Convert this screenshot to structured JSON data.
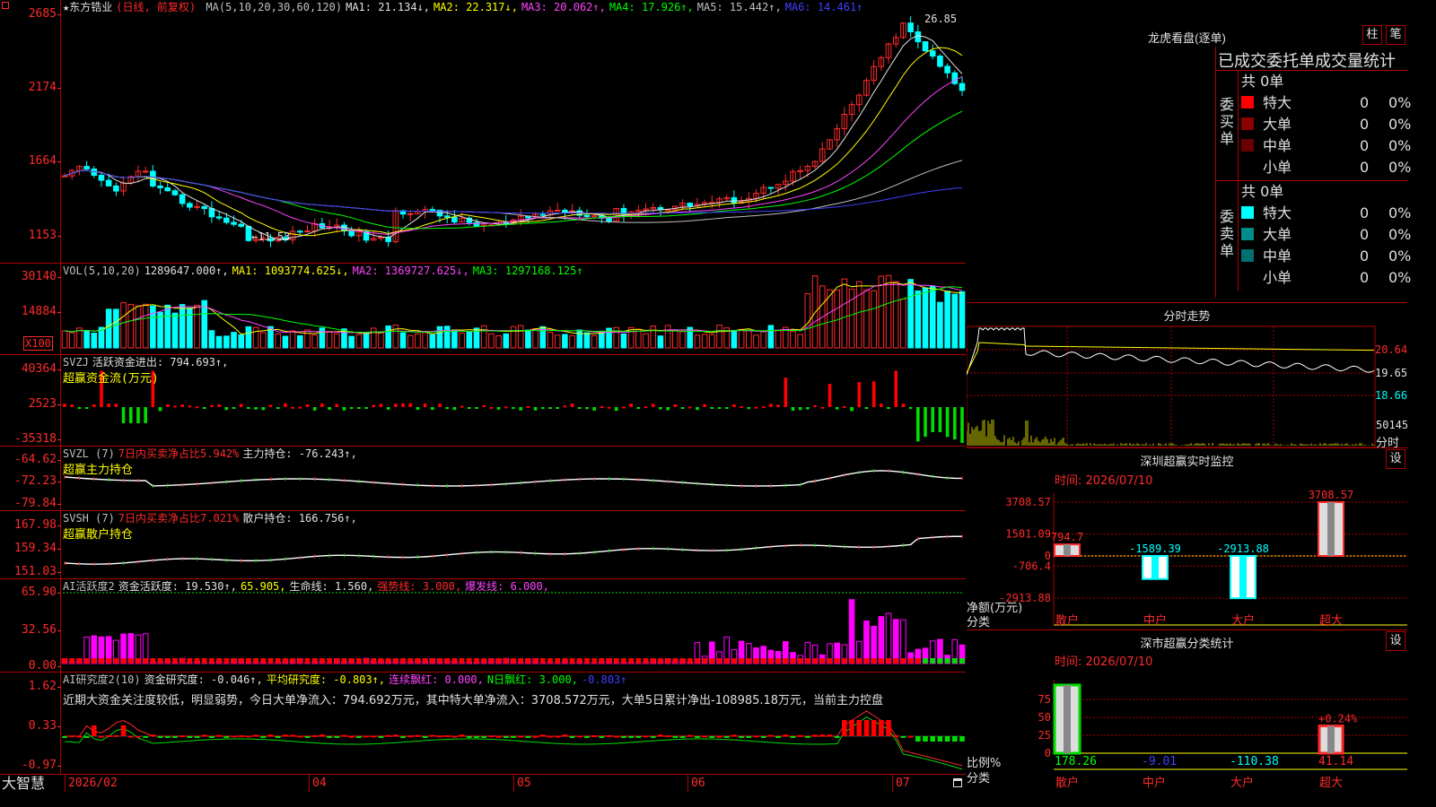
{
  "stock": {
    "name": "★东方锆业",
    "period": "(日线, 前复权)"
  },
  "kline": {
    "legend": [
      {
        "text": "MA(5,10,20,30,60,120)",
        "color": "#c0c0c0"
      },
      {
        "text": "MA1: 21.134↓,",
        "color": "#e0e0e0"
      },
      {
        "text": "MA2: 22.317↓,",
        "color": "#ffff00"
      },
      {
        "text": "MA3: 20.062↑,",
        "color": "#ff44ff"
      },
      {
        "text": "MA4: 17.926↑,",
        "color": "#00ff00"
      },
      {
        "text": "MA5: 15.442↑,",
        "color": "#c0c0c0"
      },
      {
        "text": "MA6: 14.461↑",
        "color": "#4040ff"
      }
    ],
    "ticks": [
      "2685",
      "2174",
      "1664",
      "1153"
    ],
    "high_label": "26.85",
    "low_label": "←11.53"
  },
  "vol": {
    "legend": [
      {
        "text": "VOL(5,10,20)",
        "color": "#c0c0c0"
      },
      {
        "text": "1289647.000↑,",
        "color": "#e0e0e0"
      },
      {
        "text": "MA1: 1093774.625↓,",
        "color": "#ffff00"
      },
      {
        "text": "MA2: 1369727.625↓,",
        "color": "#ff44ff"
      },
      {
        "text": "MA3: 1297168.125↑",
        "color": "#00ff00"
      }
    ],
    "ticks": [
      "30140",
      "14884"
    ],
    "unit": "X100"
  },
  "svzj": {
    "legend": [
      {
        "text": "SVZJ",
        "color": "#c0c0c0"
      },
      {
        "text": "活跃资金进出: 794.693↑,",
        "color": "#e0e0e0"
      }
    ],
    "sub": "超赢资金流(万元)",
    "ticks": [
      "40364",
      "2523",
      "-35318"
    ]
  },
  "svzl": {
    "legend": [
      {
        "text": "SVZL (7)",
        "color": "#c0c0c0"
      },
      {
        "text": "7日内买卖净占比5.942%",
        "color": "#ff2a2a"
      },
      {
        "text": "主力持仓: -76.243↑,",
        "color": "#e0e0e0"
      }
    ],
    "sub": "超赢主力持仓",
    "ticks": [
      "-64.62",
      "-72.23",
      "-79.84"
    ]
  },
  "svsh": {
    "legend": [
      {
        "text": "SVSH (7)",
        "color": "#c0c0c0"
      },
      {
        "text": "7日内买卖净占比7.021%",
        "color": "#ff2a2a"
      },
      {
        "text": "散户持仓: 166.756↑,",
        "color": "#e0e0e0"
      }
    ],
    "sub": "超赢散户持仓",
    "ticks": [
      "167.98",
      "159.34",
      "151.03"
    ]
  },
  "ai1": {
    "legend": [
      {
        "text": "AI活跃度2",
        "color": "#c0c0c0"
      },
      {
        "text": "资金活跃度: 19.530↑,",
        "color": "#e0e0e0"
      },
      {
        "text": "65.905,",
        "color": "#ffff00"
      },
      {
        "text": "生命线: 1.560,",
        "color": "#e0e0e0"
      },
      {
        "text": "强势线: 3.000,",
        "color": "#ff2a2a"
      },
      {
        "text": "爆发线: 6.000,",
        "color": "#ff44ff"
      }
    ],
    "ticks": [
      "65.90",
      "32.56",
      "0.00"
    ]
  },
  "ai2": {
    "legend": [
      {
        "text": "AI研究度2(10)",
        "color": "#c0c0c0"
      },
      {
        "text": "资金研究度: -0.046↑,",
        "color": "#e0e0e0"
      },
      {
        "text": "平均研究度: -0.803↑,",
        "color": "#ffff00"
      },
      {
        "text": "连续飘红: 0.000,",
        "color": "#ff44ff"
      },
      {
        "text": "N日飘红: 3.000,",
        "color": "#00ff00"
      },
      {
        "text": "-0.803↑",
        "color": "#4040ff"
      }
    ],
    "comment": "近期大资金关注度较低，明显弱势，今日大单净流入：794.692万元，其中特大单净流入：3708.572万元，大单5日累计净出-108985.18万元，当前主力控盘",
    "ticks": [
      "1.62",
      "0.33",
      "-0.97"
    ]
  },
  "dates": [
    "2026/02",
    "04",
    "05",
    "06",
    "07"
  ],
  "brand": "大智慧",
  "longhu": {
    "title": "龙虎看盘(逐单)",
    "btn1": "柱",
    "btn2": "笔",
    "header": "已成交委托单成交量统计",
    "buy_label": "委买单",
    "sell_label": "委卖单",
    "buy_total": "共 0单",
    "sell_total": "共 0单",
    "buy_rows": [
      {
        "label": "特大",
        "value": "0",
        "pct": "0%",
        "color": "#ff0000"
      },
      {
        "label": "大单",
        "value": "0",
        "pct": "0%",
        "color": "#8b0000"
      },
      {
        "label": "中单",
        "value": "0",
        "pct": "0%",
        "color": "#6a0000"
      },
      {
        "label": "小单",
        "value": "0",
        "pct": "0%",
        "color": "#000000"
      }
    ],
    "sell_rows": [
      {
        "label": "特大",
        "value": "0",
        "pct": "0%",
        "color": "#00ffff"
      },
      {
        "label": "大单",
        "value": "0",
        "pct": "0%",
        "color": "#008b8b"
      },
      {
        "label": "中单",
        "value": "0",
        "pct": "0%",
        "color": "#007070"
      },
      {
        "label": "小单",
        "value": "0",
        "pct": "0%",
        "color": "#000000"
      }
    ]
  },
  "fenshi": {
    "title": "分时走势",
    "ticks": [
      "20.64",
      "19.65",
      "18.66"
    ],
    "vol_tick": "50145",
    "unit": "分时"
  },
  "monitor": {
    "title": "深圳超赢实时监控",
    "btn": "设",
    "date": "时间: 2026/07/10",
    "y_ticks": [
      "3708.57",
      "1501.09",
      "0",
      "-706.4",
      "-2913.88"
    ],
    "axis_label": "净额(万元)",
    "cat_label": "分类",
    "categories": [
      "散户",
      "中户",
      "大户",
      "超大"
    ],
    "values": [
      794.7,
      -1589.39,
      -2913.88,
      3708.57
    ],
    "labels": [
      "794.7",
      "-1589.39",
      "-2913.88",
      "3708.57"
    ],
    "label_colors": [
      "#ff2a2a",
      "#00ffff",
      "#00ffff",
      "#ff2a2a"
    ]
  },
  "classify": {
    "title": "深市超赢分类统计",
    "btn": "设",
    "date": "时间: 2026/07/10",
    "y_ticks": [
      "75",
      "50",
      "25",
      "0"
    ],
    "axis_label": "比例%",
    "cat_label": "分类",
    "categories": [
      "散户",
      "中户",
      "大户",
      "超大"
    ],
    "values": [
      "178.26",
      "-9.01",
      "-110.38",
      "41.14"
    ],
    "value_colors": [
      "#00ff00",
      "#4040ff",
      "#00ffff",
      "#ff2a2a"
    ],
    "extra_label": "+0.24%"
  }
}
